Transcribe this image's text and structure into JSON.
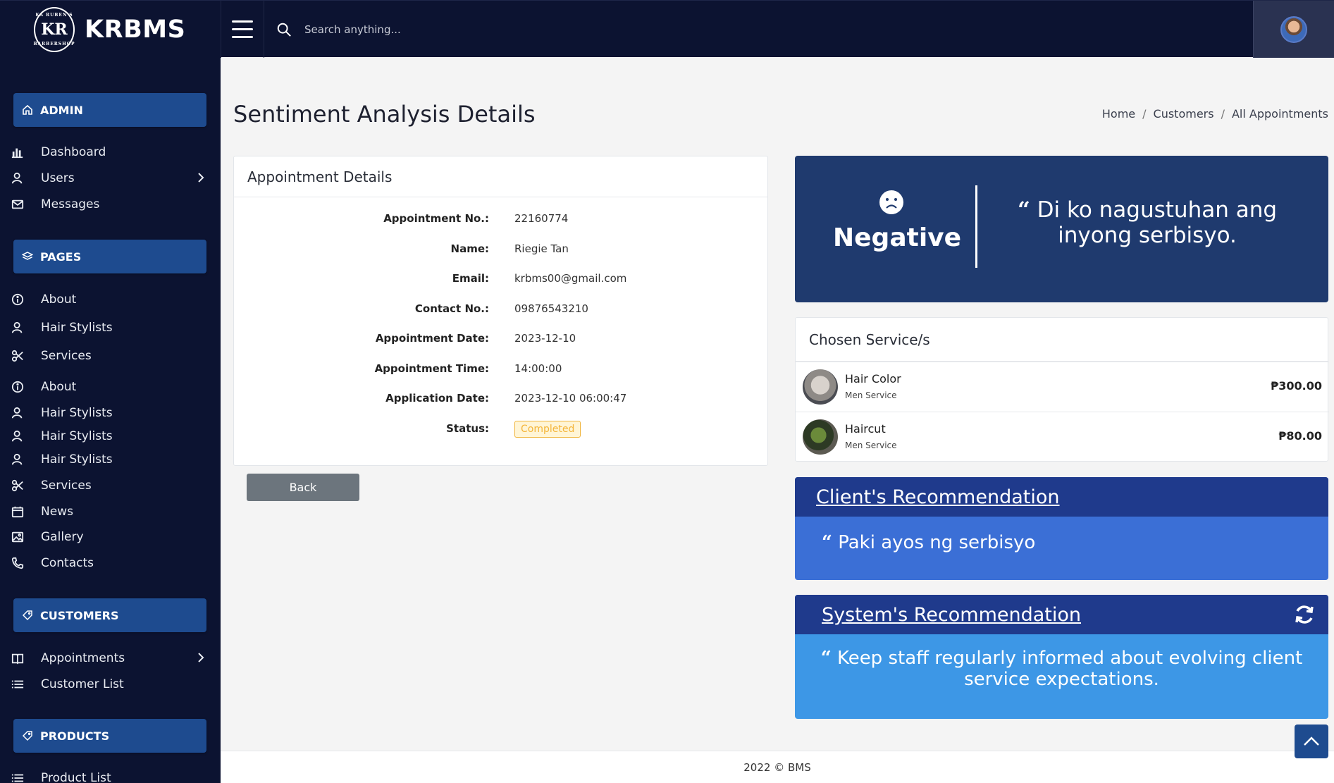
{
  "app": {
    "brand": "KRBMS",
    "logo_text": "KR",
    "logo_top": "KA RUBEN'S",
    "logo_bottom": "BARBERSHOP"
  },
  "topbar": {
    "search_placeholder": "Search anything..."
  },
  "sidebar": {
    "sections": {
      "admin": "ADMIN",
      "pages": "PAGES",
      "customers": "CUSTOMERS",
      "products": "PRODUCTS"
    },
    "items": [
      {
        "label": "Dashboard",
        "icon": "bar-chart-icon"
      },
      {
        "label": "Users",
        "icon": "users-icon"
      },
      {
        "label": "Messages",
        "icon": "envelope-icon"
      },
      {
        "label": "About",
        "icon": "info-icon"
      },
      {
        "label": "Hair Stylists",
        "icon": "users-icon"
      },
      {
        "label": "Services",
        "icon": "scissors-icon"
      },
      {
        "label": "About",
        "icon": "info-icon"
      },
      {
        "label": "Hair Stylists",
        "icon": "users-icon"
      },
      {
        "label": "Hair Stylists",
        "icon": "users-icon"
      },
      {
        "label": "Hair Stylists",
        "icon": "users-icon"
      },
      {
        "label": "Services",
        "icon": "scissors-icon"
      },
      {
        "label": "News",
        "icon": "calendar-icon"
      },
      {
        "label": "Gallery",
        "icon": "image-icon"
      },
      {
        "label": "Contacts",
        "icon": "phone-icon"
      },
      {
        "label": "Appointments",
        "icon": "book-icon"
      },
      {
        "label": "Customer List",
        "icon": "list-icon"
      },
      {
        "label": "Product List",
        "icon": "list-icon"
      }
    ]
  },
  "page": {
    "title": "Sentiment Analysis Details",
    "breadcrumb": [
      "Home",
      "Customers",
      "All Appointments"
    ]
  },
  "appointment": {
    "header": "Appointment Details",
    "rows": [
      {
        "label": "Appointment No.:",
        "value": "22160774"
      },
      {
        "label": "Name:",
        "value": "Riegie Tan"
      },
      {
        "label": "Email:",
        "value": "krbms00@gmail.com"
      },
      {
        "label": "Contact No.:",
        "value": "09876543210"
      },
      {
        "label": "Appointment Date:",
        "value": "2023-12-10"
      },
      {
        "label": "Appointment Time:",
        "value": "14:00:00"
      },
      {
        "label": "Application Date:",
        "value": "2023-12-10 06:00:47"
      },
      {
        "label": "Status:",
        "value": "Completed"
      }
    ],
    "back_label": "Back"
  },
  "sentiment": {
    "label": "Negative",
    "quote": "Di ko nagustuhan ang inyong serbisyo.",
    "color": "#1f3a6e"
  },
  "services": {
    "header": "Chosen Service/s",
    "items": [
      {
        "name": "Hair Color",
        "category": "Men Service",
        "price": "₱300.00"
      },
      {
        "name": "Haircut",
        "category": "Men Service",
        "price": "₱80.00"
      }
    ]
  },
  "client_recommendation": {
    "title": "Client's Recommendation",
    "text": "Paki ayos ng serbisyo"
  },
  "system_recommendation": {
    "title": "System's Recommendation",
    "text": "Keep staff regularly informed about evolving client service expectations."
  },
  "footer": {
    "text": "2022 © BMS"
  },
  "colors": {
    "sidebar_bg": "#0c1331",
    "section_btn": "#1e4b8f",
    "status_badge": "#f4b53a"
  }
}
